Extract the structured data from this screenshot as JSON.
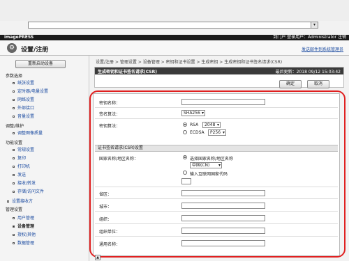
{
  "browser": {
    "url_value": "",
    "dropdown_glyph": "▾"
  },
  "topbar": {
    "brand": "imagePRESS",
    "menu_link": "到门户",
    "user_label": "登录用户：Administrator",
    "logout_link": "注销"
  },
  "header": {
    "title": "设置/注册",
    "icon": "wrench-icon",
    "link": "发送邮件到系统管理员"
  },
  "sidebar": {
    "restart_button": "重新启动设备",
    "sections": [
      {
        "label": "参数选择",
        "items": [
          "纸张设置",
          "定时器/电量设置",
          "网络设置",
          "外部接口",
          "音量设置"
        ]
      },
      {
        "label": "调整/维护",
        "items": [
          "调整图像质量"
        ]
      },
      {
        "label": "功能设置",
        "items": [
          "常规设置",
          "复印",
          "打印机",
          "发送",
          "接收/转发",
          "存储/访问文件"
        ]
      },
      {
        "label": "",
        "items": [
          "设置接收方"
        ]
      },
      {
        "label": "管理设置",
        "items": [
          "用户管理",
          "设备管理",
          "授权/其他",
          "数据管理"
        ]
      }
    ],
    "active_item": "设备管理"
  },
  "breadcrumb": "设置/注册 > 管理设置 > 设备管理 > 密钥和证书设置 > 生成密钥 > 生成密钥和证书签名请求(CSR)",
  "panel": {
    "title": "生成密钥和证书签名请求(CSR)",
    "last_updated": "最后更新：2018 09/12 15:03:42",
    "ok_button": "确定",
    "cancel_button": "取消"
  },
  "form": {
    "key_name_label": "密钥名称：",
    "key_name_value": "",
    "sig_alg_label": "签名算法：",
    "sig_alg_value": "SHA256",
    "key_alg_label": "密钥算法：",
    "rsa_label": "RSA",
    "rsa_size": "2048",
    "ecdsa_label": "ECDSA",
    "ecdsa_size": "P256",
    "csr_section_title": "证书签名请求(CSR)设置",
    "country_label": "国家名称/地区名称：",
    "country_option_select": "选择国家名称/地区名称",
    "country_value": "中国(CN)",
    "country_option_input": "输入互联网国家代码",
    "country_code_value": "",
    "state_label": "省区：",
    "city_label": "城市：",
    "org_label": "组织：",
    "unit_label": "组织单位：",
    "common_name_label": "通用名称：",
    "state_value": "",
    "city_value": "",
    "org_value": "",
    "unit_value": "",
    "common_name_value": ""
  },
  "colors": {
    "highlight": "#e02020",
    "link": "#1a4aa0",
    "header_bar": "#1a1a1a"
  }
}
